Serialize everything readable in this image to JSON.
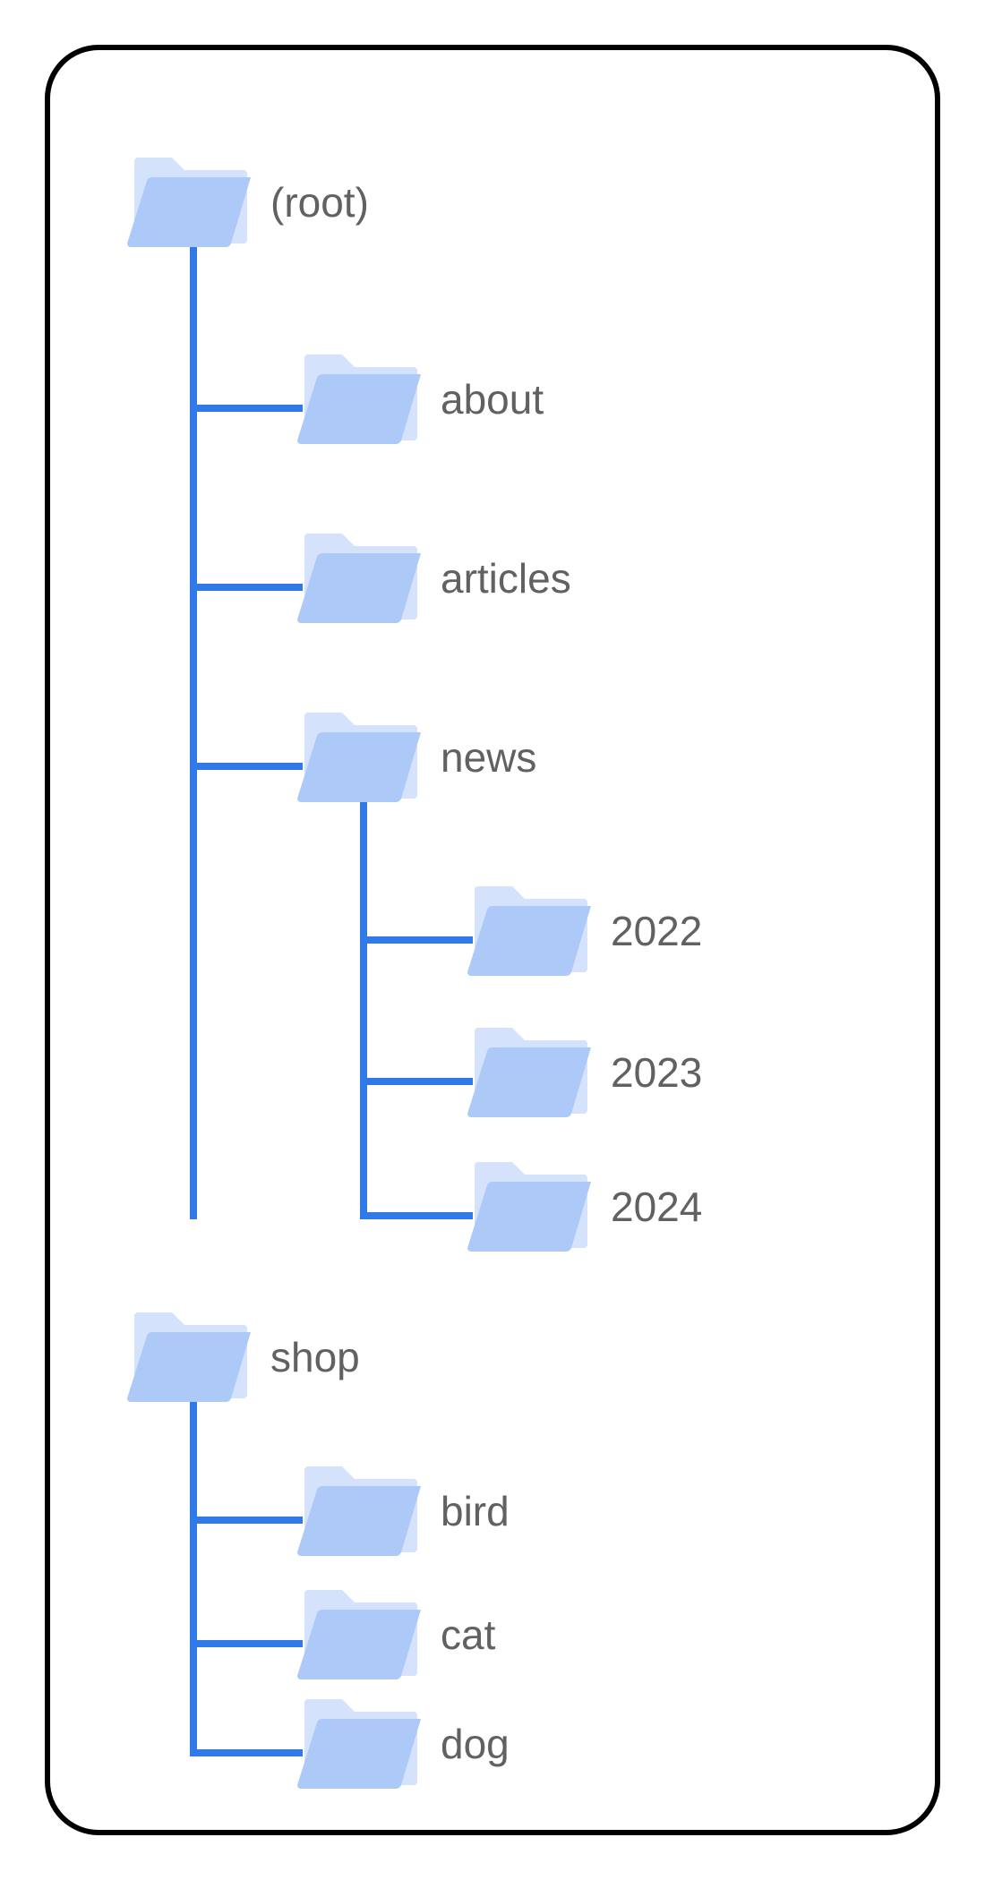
{
  "colors": {
    "folder_light": "#d4e3fb",
    "folder_dark": "#acc9f7",
    "line": "#2f79e8",
    "label": "#616161",
    "border": "#000000"
  },
  "tree": {
    "root": {
      "label": "(root)",
      "children": [
        {
          "label": "about"
        },
        {
          "label": "articles"
        },
        {
          "label": "news",
          "children": [
            {
              "label": "2022"
            },
            {
              "label": "2023"
            },
            {
              "label": "2024"
            }
          ]
        }
      ]
    },
    "shop": {
      "label": "shop",
      "children": [
        {
          "label": "bird"
        },
        {
          "label": "cat"
        },
        {
          "label": "dog"
        }
      ]
    }
  }
}
